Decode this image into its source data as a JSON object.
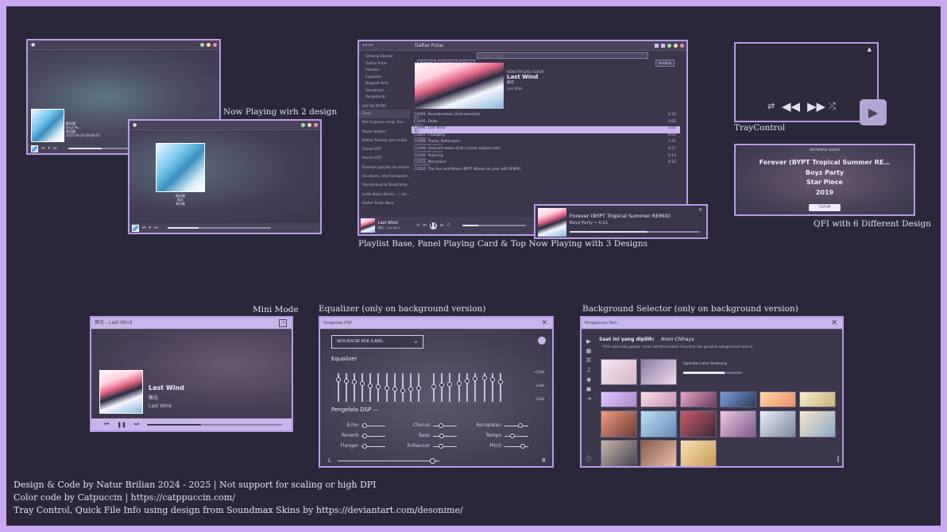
{
  "captions": {
    "now_playing": "Now Playing wirh 2 design",
    "playlist": "Playlist Base, Panel Playing Card & Top Now Playing with 3 Designs",
    "tray": "TrayControl",
    "qfi": "QFI with 6 Different Design",
    "mini": "Mini Mode",
    "equalizer": "Equalizer (only on background version)",
    "bg_selector": "Background Selector (only on background version)"
  },
  "footer": {
    "line1": "Design & Code  by Natur Brilian 2024 - 2025 | Not support for scaling or high DPI",
    "line2": "Color code by Catpuccin | https://catppuccin.com/",
    "line3": "Tray Control, Quick File Info using design from Soundmax Skins by https://deviantart.com/desonime/"
  },
  "playlist_window": {
    "title": "Daftar Putar",
    "toolbar": {
      "btn1": "Tambah",
      "btn2": "Lain-lain",
      "btn3": "Hapus",
      "search_placeholder": "Pencarian cepat",
      "btn4": "Urutkan",
      "btn5": "Daftar"
    },
    "sidebar": [
      "Sedang Diputar",
      "Daftar Putar",
      "Pustaka",
      "Equalizer",
      "Biografi Artis",
      "Visualisasi",
      "Pengaturan"
    ],
    "sidebar_header": "DAFTAR PUTAR",
    "playlists": [
      "Tune",
      "Nat terpenin song, Son...",
      "Radio station",
      "Ketika Tenang dan musik",
      "Game OST",
      "Anime OST",
      "Random playlist ah mnme...",
      "Facebook, and Instagram...",
      "Soundcloud & Bandcamp",
      "Lotte Natur Brilian - i nai...",
      "Daftar Putar Baru"
    ],
    "album_label": "MEMUTAR DARI ALBUM",
    "album_title": "Last Wind",
    "album_artist": "舞花",
    "album_sub": "Last Wink",
    "tracks": [
      {
        "title": "C2494. Reverberation (Instrumental)",
        "artist": "舞花",
        "dur": "4:32"
      },
      {
        "title": "C2495. Delta",
        "artist": "Delta's",
        "dur": "1:02"
      },
      {
        "title": "C2496. Last Wind",
        "artist": "舞花",
        "dur": "3:47"
      },
      {
        "title": "C2497. Changing",
        "artist": "Undertow",
        "dur": "6:03"
      },
      {
        "title": "C2498. Tiome, Ballerophn",
        "artist": "Circuitbender (sound)",
        "dur": "1:31"
      },
      {
        "title": "C2499. crescent moon (Erik n lunar eclipse mix)",
        "artist": "Circuitbender (sound)",
        "dur": "4:27"
      },
      {
        "title": "C2500. Yearning",
        "artist": "Undertow",
        "dur": "5:13"
      },
      {
        "title": "C2501. Merryland",
        "artist": "BOYZ PARTY",
        "dur": "4:22"
      },
      {
        "title": "C2502. The Sun and Moon (BYPT Waves on your left REMIX)",
        "artist": "",
        "dur": ""
      }
    ],
    "now_title": "Last Wind",
    "now_artist": "舞花 - Last Wink"
  },
  "panel_card": {
    "title": "Forever (BYPT Tropical Summer REMIX)",
    "artist": "Boyz Party • 4:11"
  },
  "nowplaying1": {
    "title": "舞花綴",
    "l2": "Boyz Pa...",
    "l3": "舞花綴",
    "l4": "2025-04-23 09:46:42"
  },
  "nowplaying2": {
    "title": "舞花綴",
    "artist": "舞花",
    "album": "海月美"
  },
  "qfi": {
    "header": "INFORMASI ALBUM",
    "title": "Forever (BYPT Tropical Summer RE…",
    "artist": "Boyz Party",
    "album": "Star Piece",
    "year": "2019",
    "close": "TUTUP"
  },
  "mini": {
    "title": "舞花 - Last Wind",
    "track": "Last Wind",
    "artist": "舞花",
    "album": "Last Wink"
  },
  "eq": {
    "title": "Pengelola DSP",
    "preset": "WOI KOCAK KOK ILANG",
    "eq_label": "Equalizer",
    "db": [
      "+12dB",
      "+0dB",
      "-12dB"
    ],
    "eq_levels": [
      0.82,
      0.78,
      0.72,
      0.68,
      0.58,
      0.55,
      0.46,
      0.42,
      0.38,
      0.44,
      0.48,
      0.52,
      0.6,
      0.62,
      0.68,
      0.78,
      0.86,
      0.9,
      0.82,
      0.74
    ],
    "dsp_label": "Pengelola DSP",
    "rows": [
      {
        "name": "Echo",
        "level": 0.05
      },
      {
        "name": "Chorus",
        "level": 0.3
      },
      {
        "name": "Kecepatan",
        "level": 0.7
      },
      {
        "name": "Reverb",
        "level": 0.05
      },
      {
        "name": "Bass",
        "level": 0.35
      },
      {
        "name": "Tempo",
        "level": 0.3
      },
      {
        "name": "Flanger",
        "level": 0.05
      },
      {
        "name": "Enhancer",
        "level": 0.3
      },
      {
        "name": "Pitch",
        "level": 0.85
      }
    ],
    "balance_left": "L",
    "balance_right": "R",
    "balance": 0.93
  },
  "bgsel": {
    "title": "Pengaturan Skin",
    "current_label": "Saat ini yang dipilih:",
    "current_value": "Anon Chihaya",
    "note": "*Pilih salah satu gambar untuk memilih karakter favoritmu dan gunakan sebagai tema saat ini.",
    "opacity_label": "Opasitas Latar Belakang",
    "opacity": 0.7
  },
  "colors": {
    "accent": "#c8a8f0",
    "bg": "#2a2838",
    "window": "#3b3649",
    "red": "#f38ba8",
    "yellow": "#f9e2af",
    "green": "#a6e3a1"
  }
}
